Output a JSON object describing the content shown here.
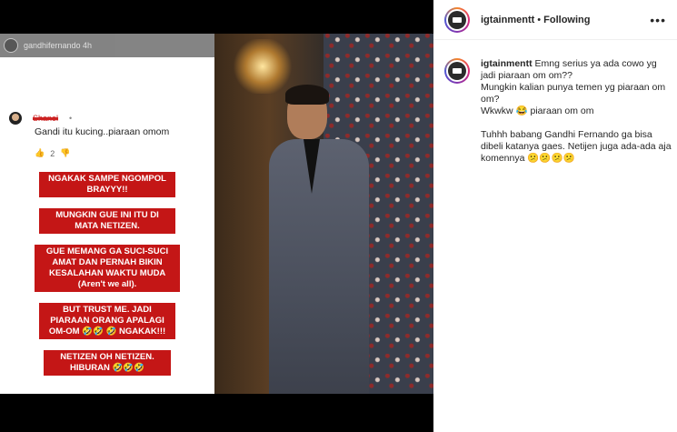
{
  "story": {
    "header_user": "gandhifernando 4h",
    "comment": {
      "name": "Shanel",
      "dot": "•",
      "text": "Gandi itu kucing..piaraan omom",
      "likes": "2"
    },
    "captions": [
      "NGAKAK SAMPE NGOMPOL BRAYYY!!",
      "MUNGKIN GUE INI ITU DI MATA NETIZEN.",
      "GUE MEMANG GA SUCI-SUCI AMAT DAN PERNAH BIKIN KESALAHAN WAKTU MUDA",
      "(Aren't we all).",
      "BUT TRUST ME. JADI PIARAAN ORANG APALAGI OM-OM 🤣🤣 🤣 NGAKAK!!!",
      "NETIZEN OH NETIZEN. HIBURAN 🤣🤣🤣"
    ]
  },
  "panel": {
    "username": "igtainmentt",
    "dot": "•",
    "following": "Following",
    "more_icon": "more-icon",
    "caption_user": "igtainmentt",
    "caption_lines": [
      "Emng serius ya ada cowo yg jadi piaraan om om??",
      "Mungkin kalian punya temen yg piaraan om om?",
      "Wkwkw 😂 piaraan om om"
    ],
    "caption_paragraph": "Tuhhh babang Gandhi Fernando ga bisa dibeli katanya gaes. Netijen juga ada-ada aja komennya 😕😕😕😕"
  }
}
